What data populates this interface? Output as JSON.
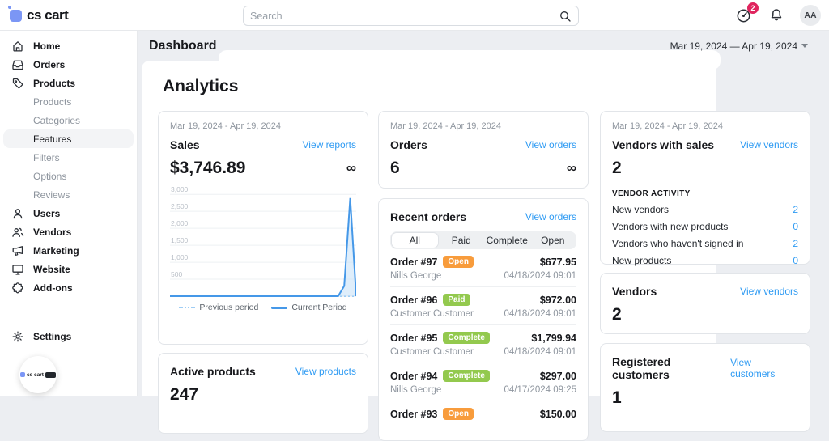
{
  "topbar": {
    "logo_text": "cs cart",
    "search_placeholder": "Search",
    "gauge_badge_count": "2",
    "avatar_initials": "AA"
  },
  "sidebar": {
    "items": [
      {
        "label": "Home",
        "icon": "home-icon"
      },
      {
        "label": "Orders",
        "icon": "orders-icon"
      },
      {
        "label": "Products",
        "icon": "tag-icon"
      },
      {
        "label": "Products"
      },
      {
        "label": "Categories"
      },
      {
        "label": "Features",
        "active": true
      },
      {
        "label": "Filters"
      },
      {
        "label": "Options"
      },
      {
        "label": "Reviews"
      },
      {
        "label": "Users",
        "icon": "user-icon"
      },
      {
        "label": "Vendors",
        "icon": "vendors-icon"
      },
      {
        "label": "Marketing",
        "icon": "megaphone-icon"
      },
      {
        "label": "Website",
        "icon": "monitor-icon"
      },
      {
        "label": "Add-ons",
        "icon": "puzzle-icon"
      },
      {
        "label": "Settings",
        "icon": "gear-icon"
      }
    ],
    "widget_logo_text": "cs cart"
  },
  "header": {
    "title": "Dashboard",
    "date_range": "Mar 19, 2024 — Apr 19, 2024"
  },
  "analytics": {
    "title": "Analytics"
  },
  "sales_card": {
    "date_range": "Mar 19, 2024 - Apr 19, 2024",
    "title": "Sales",
    "link": "View reports",
    "value": "$3,746.89",
    "infinity": "∞"
  },
  "orders_card": {
    "date_range": "Mar 19, 2024 - Apr 19, 2024",
    "title": "Orders",
    "link": "View orders",
    "value": "6",
    "infinity": "∞"
  },
  "vendors_sales_card": {
    "date_range": "Mar 19, 2024 - Apr 19, 2024",
    "title": "Vendors with sales",
    "link": "View vendors",
    "value": "2",
    "activity_title": "VENDOR ACTIVITY",
    "activity": [
      {
        "label": "New vendors",
        "value": "2"
      },
      {
        "label": "Vendors with new products",
        "value": "0"
      },
      {
        "label": "Vendors who haven't signed in",
        "value": "2"
      },
      {
        "label": "New products",
        "value": "0"
      }
    ]
  },
  "recent_orders_card": {
    "title": "Recent orders",
    "link": "View orders",
    "tabs": [
      "All",
      "Paid",
      "Complete",
      "Open"
    ],
    "active_tab": "All",
    "orders": [
      {
        "id": "Order #97",
        "status": "Open",
        "status_color": "#f89c3c",
        "amount": "$677.95",
        "customer": "Nills George",
        "date": "04/18/2024 09:01"
      },
      {
        "id": "Order #96",
        "status": "Paid",
        "status_color": "#93c94e",
        "amount": "$972.00",
        "customer": "Customer Customer",
        "date": "04/18/2024 09:01"
      },
      {
        "id": "Order #95",
        "status": "Complete",
        "status_color": "#93c94e",
        "amount": "$1,799.94",
        "customer": "Customer Customer",
        "date": "04/18/2024 09:01"
      },
      {
        "id": "Order #94",
        "status": "Complete",
        "status_color": "#93c94e",
        "amount": "$297.00",
        "customer": "Nills George",
        "date": "04/17/2024 09:25"
      },
      {
        "id": "Order #93",
        "status": "Open",
        "status_color": "#f89c3c",
        "amount": "$150.00",
        "customer": "",
        "date": ""
      }
    ]
  },
  "vendors_card": {
    "title": "Vendors",
    "link": "View vendors",
    "value": "2"
  },
  "customers_card": {
    "title": "Registered customers",
    "link": "View customers",
    "value": "1"
  },
  "products_card": {
    "title": "Active products",
    "link": "View products",
    "value": "247"
  },
  "chart_data": {
    "type": "area",
    "title": "Sales",
    "xlabel": "",
    "ylabel": "",
    "x_range": [
      "Mar 19, 2024",
      "Apr 19, 2024"
    ],
    "y_ticks": [
      500,
      1000,
      1500,
      2000,
      2500,
      3000
    ],
    "ylim": [
      0,
      3100
    ],
    "grid": true,
    "legend_position": "bottom",
    "series": [
      {
        "name": "Previous period",
        "style": "dotted",
        "color": "#9ecdf5",
        "values": [
          0,
          0,
          0,
          0,
          0,
          0,
          0,
          0,
          0,
          0,
          0,
          0,
          0,
          0,
          0,
          0,
          0,
          0,
          0,
          0,
          0,
          0,
          0,
          0,
          0,
          0,
          0,
          0,
          0,
          0,
          0,
          0
        ]
      },
      {
        "name": "Current Period",
        "style": "solid",
        "color": "#4598e8",
        "fill": "#c9e2f8",
        "values": [
          0,
          0,
          0,
          0,
          0,
          0,
          0,
          0,
          0,
          0,
          0,
          0,
          0,
          0,
          0,
          0,
          0,
          0,
          0,
          0,
          0,
          0,
          0,
          0,
          0,
          0,
          0,
          0,
          0,
          300,
          2890,
          0
        ]
      }
    ]
  },
  "colors": {
    "accent_link": "#2f9bf3",
    "badge_open": "#f89c3c",
    "badge_paid_complete": "#93c94e",
    "notification_badge": "#e0245e",
    "logo_blue": "#7b96f5",
    "chart_line": "#4598e8",
    "chart_prev": "#9ecdf5",
    "page_bg": "#eceef2"
  }
}
